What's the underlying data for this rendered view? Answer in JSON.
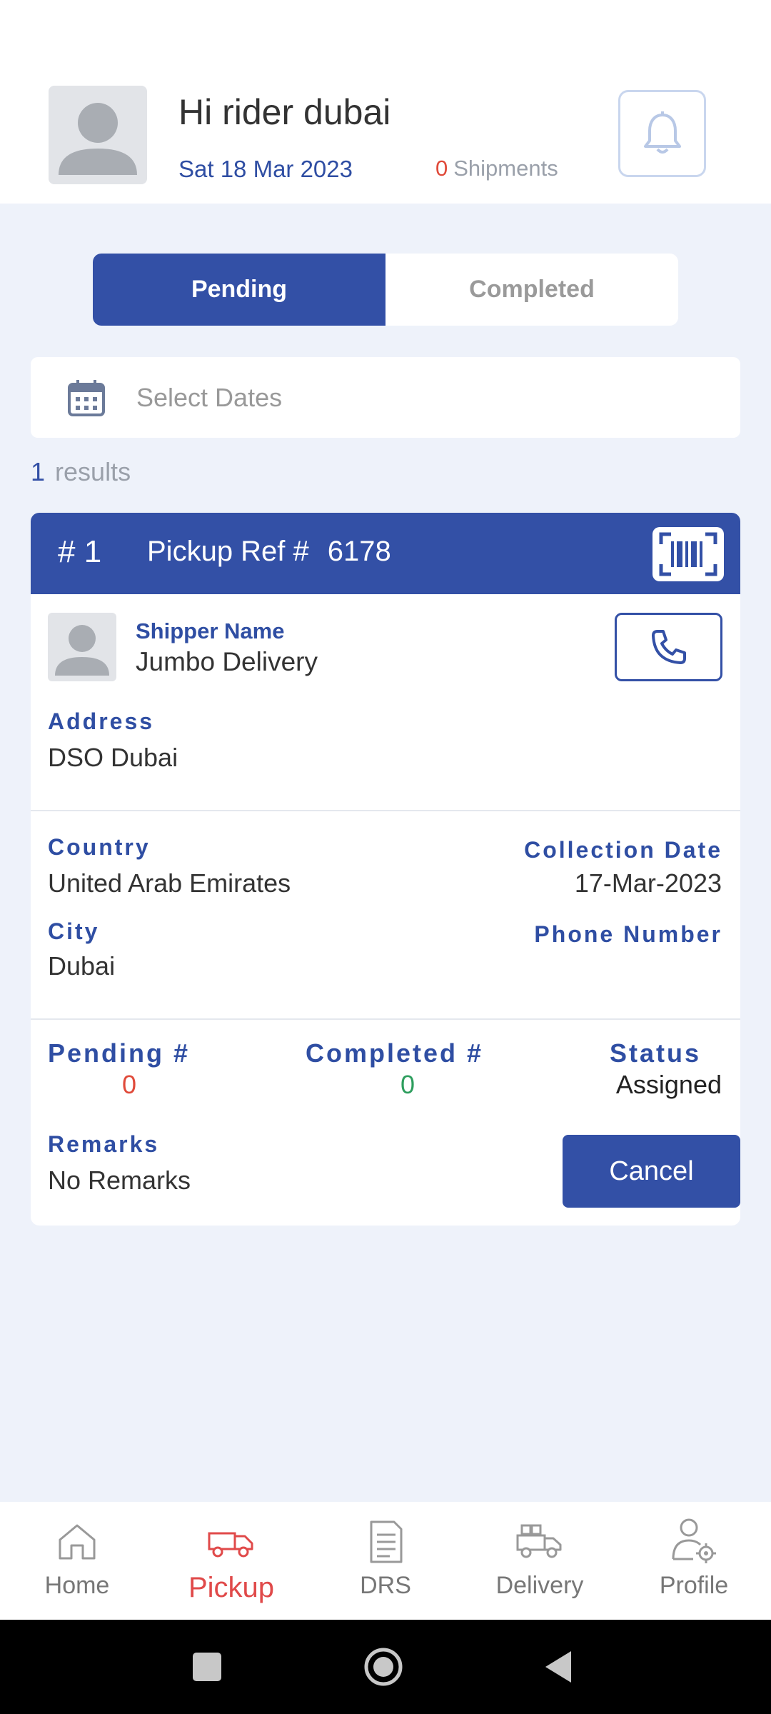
{
  "header": {
    "greeting": "Hi rider dubai",
    "date": "Sat 18 Mar 2023",
    "shipments_count": "0",
    "shipments_label": "Shipments"
  },
  "tabs": [
    {
      "label": "Pending",
      "active": true
    },
    {
      "label": "Completed",
      "active": false
    }
  ],
  "date_filter": {
    "placeholder": "Select Dates"
  },
  "results": {
    "count": "1",
    "label": "results"
  },
  "pickup_card": {
    "index": "# 1",
    "ref_label": "Pickup Ref #",
    "ref_number": "6178",
    "shipper_label": "Shipper Name",
    "shipper_name": "Jumbo Delivery",
    "address_label": "Address",
    "address": "DSO Dubai",
    "country_label": "Country",
    "country": "United Arab Emirates",
    "collection_date_label": "Collection Date",
    "collection_date": "17-Mar-2023",
    "city_label": "City",
    "city": "Dubai",
    "phone_label": "Phone Number",
    "phone": "",
    "pending_label": "Pending #",
    "pending_count": "0",
    "completed_label": "Completed #",
    "completed_count": "0",
    "status_label": "Status",
    "status": "Assigned",
    "remarks_label": "Remarks",
    "remarks": "No Remarks",
    "cancel_label": "Cancel"
  },
  "bottom_nav": [
    {
      "label": "Home",
      "icon": "home-icon",
      "active": false
    },
    {
      "label": "Pickup",
      "icon": "truck-icon",
      "active": true
    },
    {
      "label": "DRS",
      "icon": "document-icon",
      "active": false
    },
    {
      "label": "Delivery",
      "icon": "delivery-truck-icon",
      "active": false
    },
    {
      "label": "Profile",
      "icon": "profile-settings-icon",
      "active": false
    }
  ],
  "colors": {
    "primary": "#3350a6",
    "accent_red": "#e04a3a",
    "accent_green": "#2e9e5e",
    "background": "#eef2fa"
  }
}
